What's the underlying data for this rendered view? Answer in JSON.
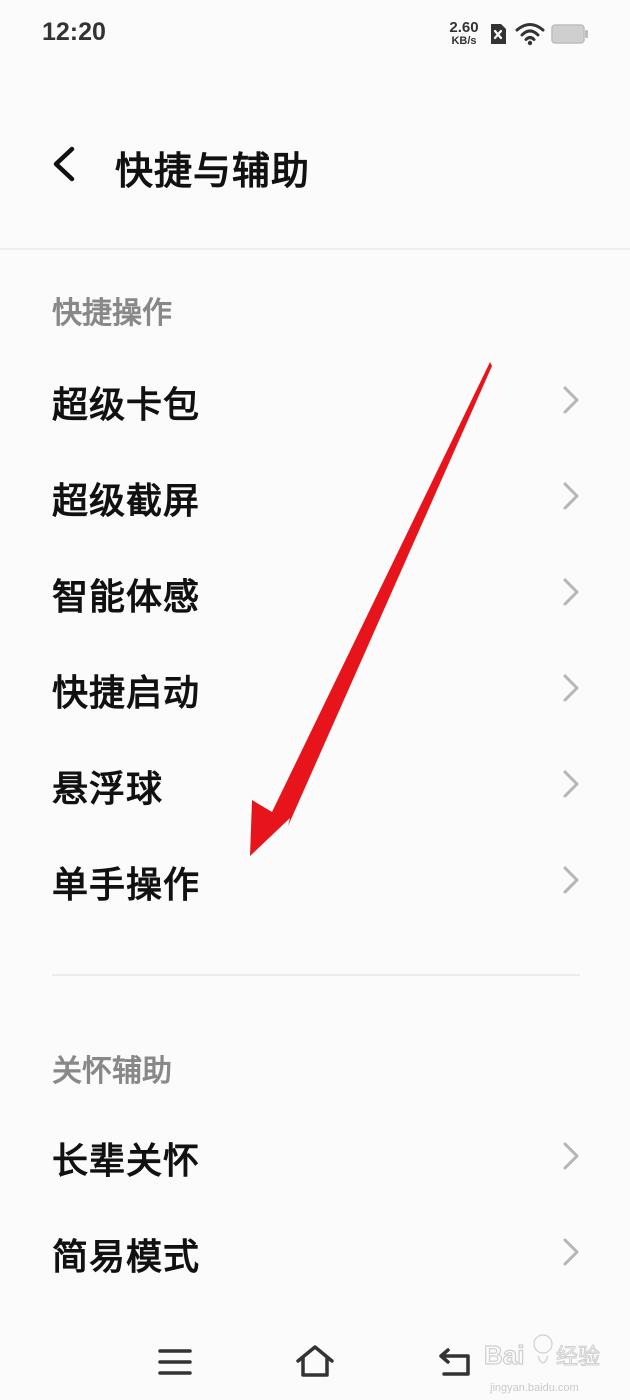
{
  "status_bar": {
    "time": "12:20",
    "net_speed_value": "2.60",
    "net_speed_unit": "KB/s",
    "icons": [
      "sim-off-icon",
      "wifi-icon",
      "battery-icon"
    ]
  },
  "header": {
    "title": "快捷与辅助",
    "back_icon": "chevron-left-icon"
  },
  "sections": [
    {
      "title": "快捷操作",
      "items": [
        "超级卡包",
        "超级截屏",
        "智能体感",
        "快捷启动",
        "悬浮球",
        "单手操作"
      ]
    },
    {
      "title": "关怀辅助",
      "items": [
        "长辈关怀",
        "简易模式"
      ]
    }
  ],
  "navigation_bar": {
    "buttons": [
      "menu-icon",
      "home-icon",
      "back-icon"
    ]
  },
  "watermark": {
    "logo_text": "Bai 经验",
    "url": "jingyan.baidu.com"
  },
  "colors": {
    "background": "#fbfbfb",
    "section_header": "#888888",
    "item_text": "#111111",
    "chevron": "#b5b5b5",
    "annotation_arrow": "#e8141b"
  }
}
